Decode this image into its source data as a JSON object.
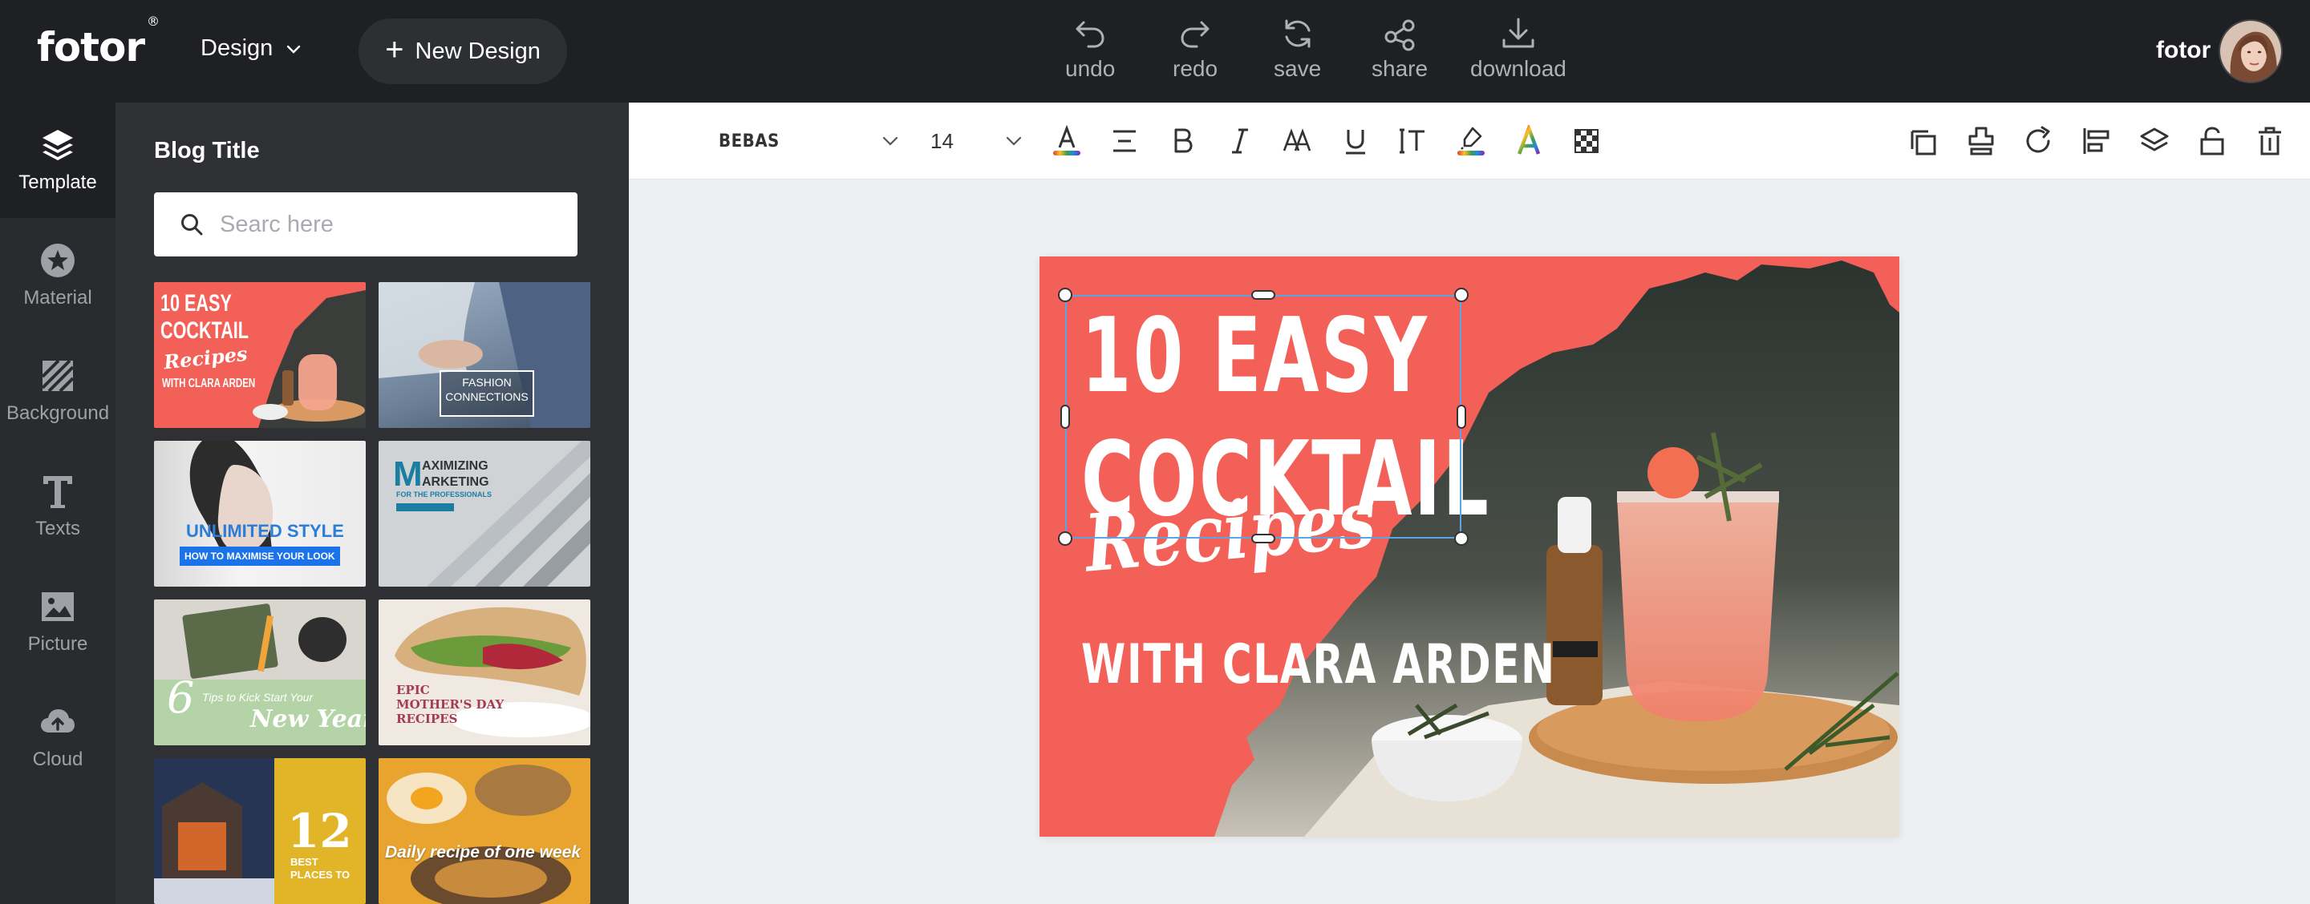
{
  "app": {
    "logo": "fotor",
    "logo_mark": "®",
    "design_menu": "Design",
    "new_design": "New Design"
  },
  "toolbar": {
    "undo": "undo",
    "redo": "redo",
    "save": "save",
    "share": "share",
    "download": "download"
  },
  "user": {
    "name": "fotor"
  },
  "rail": [
    {
      "label": "Template",
      "icon": "layers-icon"
    },
    {
      "label": "Material",
      "icon": "star-icon"
    },
    {
      "label": "Background",
      "icon": "background-icon"
    },
    {
      "label": "Texts",
      "icon": "text-icon"
    },
    {
      "label": "Picture",
      "icon": "picture-icon"
    },
    {
      "label": "Cloud",
      "icon": "cloud-icon"
    }
  ],
  "panel": {
    "title": "Blog Title",
    "search_placeholder": "Searc here"
  },
  "templates": [
    {
      "line1": "10 EASY",
      "line2": "COCKTAIL",
      "line3": "Recipes",
      "line4": "WITH CLARA ARDEN"
    },
    {
      "line1": "FASHION",
      "line2": "CONNECTIONS"
    },
    {
      "line1": "UNLIMITED STYLE",
      "line2": "HOW TO MAXIMISE YOUR LOOK"
    },
    {
      "line1": "M",
      "line2": "AXIMIZING",
      "line3": "ARKETING",
      "line4": "FOR THE PROFESSIONALS"
    },
    {
      "line1": "6",
      "line2": "Tips to Kick Start Your",
      "line3": "New Year"
    },
    {
      "line1": "EPIC",
      "line2": "MOTHER'S DAY",
      "line3": "RECIPES"
    },
    {
      "line1": "12",
      "line2": "BEST",
      "line3": "PLACES TO"
    },
    {
      "line1": "Daily recipe of one week"
    }
  ],
  "properties": {
    "font": "BEBAS",
    "size": "14"
  },
  "canvas": {
    "headline_1": "10 EASY",
    "headline_2": "COCKTAIL",
    "script": "Recipes",
    "byline": "WITH CLARA ARDEN",
    "background_color": "#f26057"
  }
}
